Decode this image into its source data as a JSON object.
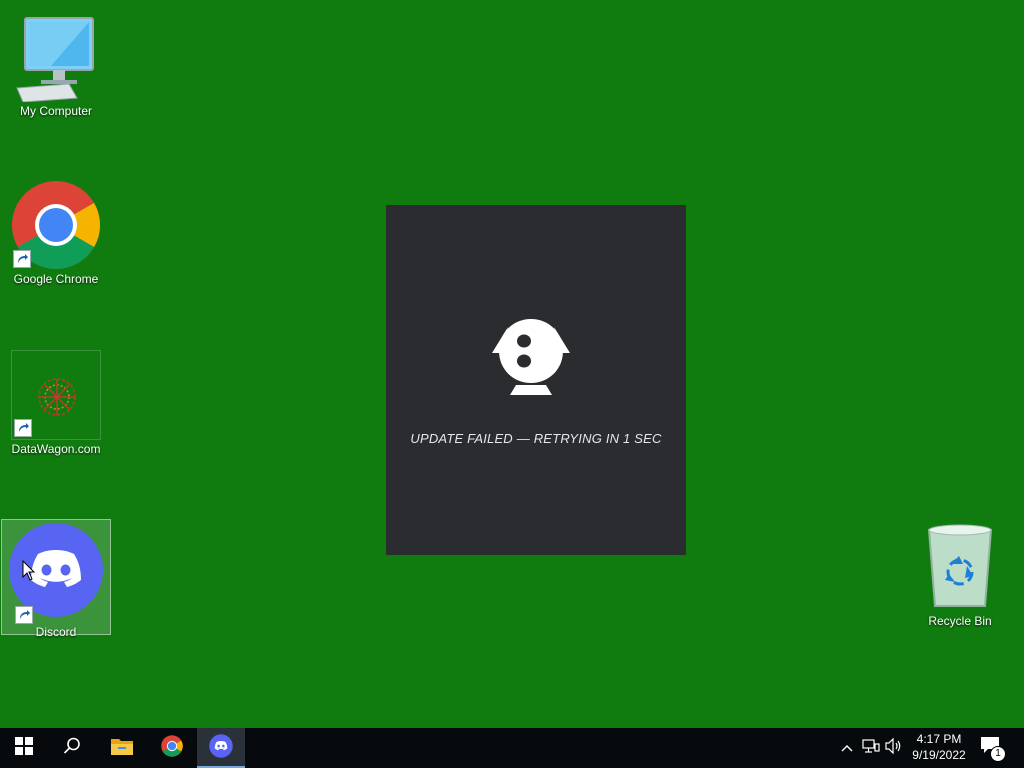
{
  "desktop": {
    "background": "#107c10",
    "icons": [
      {
        "label": "My Computer",
        "icon": "computer-icon",
        "shortcut": false
      },
      {
        "label": "Google Chrome",
        "icon": "chrome-icon",
        "shortcut": true
      },
      {
        "label": "DataWagon.com",
        "icon": "datawagon-icon",
        "shortcut": true
      },
      {
        "label": "Discord",
        "icon": "discord-icon",
        "shortcut": true,
        "selected": true
      },
      {
        "label": "Recycle Bin",
        "icon": "recycle-bin-icon",
        "shortcut": false
      }
    ]
  },
  "update_window": {
    "background": "#2b2c30",
    "status": "UPDATE FAILED — RETRYING IN 1 SEC",
    "icon": "discord-update-logo-icon"
  },
  "taskbar": {
    "background": "#060a0c",
    "buttons": [
      {
        "icon": "windows-start-icon"
      },
      {
        "icon": "search-icon"
      },
      {
        "icon": "file-explorer-icon"
      },
      {
        "icon": "chrome-icon"
      },
      {
        "icon": "discord-icon",
        "active": true
      }
    ],
    "tray": {
      "icons": [
        "chevron-up-icon",
        "network-icon",
        "volume-icon"
      ],
      "time": "4:17 PM",
      "date": "9/19/2022",
      "notification_count": "1"
    }
  },
  "colors": {
    "discord_blurple": "#5865f2",
    "accent": "#74a8de"
  }
}
